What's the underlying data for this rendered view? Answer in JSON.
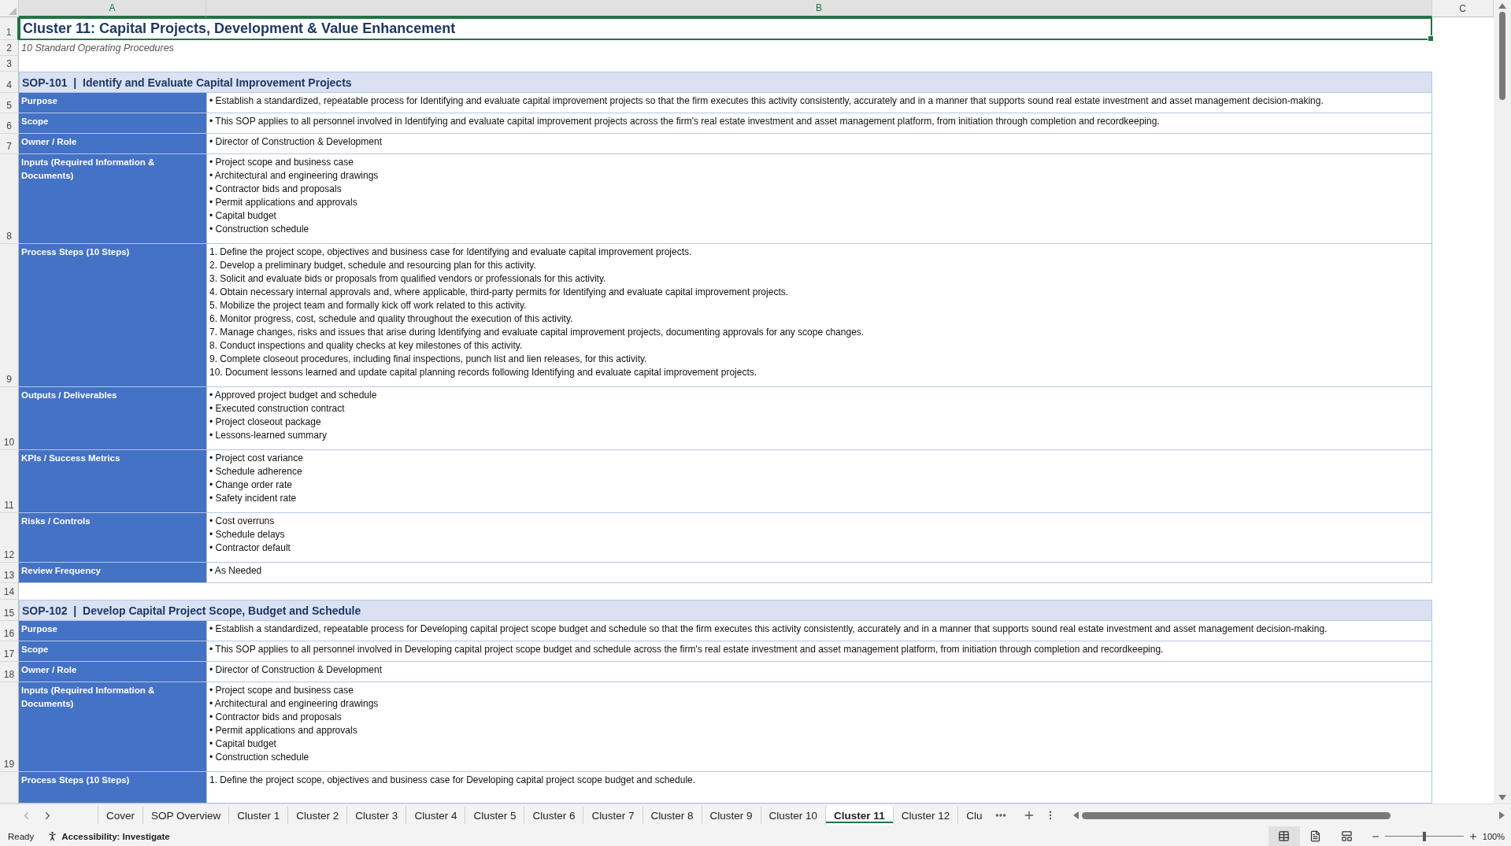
{
  "column_headers": [
    {
      "label": "A",
      "selected": true
    },
    {
      "label": "B",
      "selected": true
    },
    {
      "label": "C",
      "selected": false
    }
  ],
  "rows": [
    {
      "number": "1",
      "selected": true,
      "kind": "title",
      "text": "Cluster 11: Capital Projects, Development & Value Enhancement"
    },
    {
      "number": "2",
      "selected": false,
      "kind": "subtitle",
      "text": "10 Standard Operating Procedures"
    },
    {
      "number": "3",
      "selected": false,
      "kind": "blank"
    },
    {
      "number": "4",
      "selected": false,
      "kind": "heading",
      "text": "SOP-101  |  Identify and Evaluate Capital Improvement Projects"
    },
    {
      "number": "5",
      "selected": false,
      "kind": "field",
      "label": "Purpose",
      "lines": [
        "• Establish a standardized, repeatable process for Identifying and evaluate capital improvement projects so that the firm executes this activity consistently, accurately and in a manner that supports sound real estate investment and asset management decision-making."
      ]
    },
    {
      "number": "6",
      "selected": false,
      "kind": "field",
      "label": "Scope",
      "lines": [
        "• This SOP applies to all personnel involved in Identifying and evaluate capital improvement projects across the firm's real estate investment and asset management platform, from initiation through completion and recordkeeping."
      ]
    },
    {
      "number": "7",
      "selected": false,
      "kind": "field",
      "label": "Owner / Role",
      "lines": [
        "• Director of Construction & Development"
      ]
    },
    {
      "number": "8",
      "selected": false,
      "kind": "field",
      "label": "Inputs (Required Information & Documents)",
      "lines": [
        "• Project scope and business case",
        "• Architectural and engineering drawings",
        "• Contractor bids and proposals",
        "• Permit applications and approvals",
        "• Capital budget",
        "• Construction schedule"
      ]
    },
    {
      "number": "9",
      "selected": false,
      "kind": "field",
      "label": "Process Steps (10 Steps)",
      "lines": [
        "1. Define the project scope, objectives and business case for Identifying and evaluate capital improvement projects.",
        "2. Develop a preliminary budget, schedule and resourcing plan for this activity.",
        "3. Solicit and evaluate bids or proposals from qualified vendors or professionals for this activity.",
        "4. Obtain necessary internal approvals and, where applicable, third-party permits for Identifying and evaluate capital improvement projects.",
        "5. Mobilize the project team and formally kick off work related to this activity.",
        "6. Monitor progress, cost, schedule and quality throughout the execution of this activity.",
        "7. Manage changes, risks and issues that arise during Identifying and evaluate capital improvement projects, documenting approvals for any scope changes.",
        "8. Conduct inspections and quality checks at key milestones of this activity.",
        "9. Complete closeout procedures, including final inspections, punch list and lien releases, for this activity.",
        "10. Document lessons learned and update capital planning records following Identifying and evaluate capital improvement projects."
      ]
    },
    {
      "number": "10",
      "selected": false,
      "kind": "field",
      "label": "Outputs / Deliverables",
      "lines": [
        "• Approved project budget and schedule",
        "• Executed construction contract",
        "• Project closeout package",
        "• Lessons-learned summary"
      ]
    },
    {
      "number": "11",
      "selected": false,
      "kind": "field",
      "label": "KPIs / Success Metrics",
      "lines": [
        "• Project cost variance",
        "• Schedule adherence",
        "• Change order rate",
        "• Safety incident rate"
      ]
    },
    {
      "number": "12",
      "selected": false,
      "kind": "field",
      "label": "Risks / Controls",
      "lines": [
        "• Cost overruns",
        "• Schedule delays",
        "• Contractor default"
      ]
    },
    {
      "number": "13",
      "selected": false,
      "kind": "field",
      "label": "Review Frequency",
      "lines": [
        "• As Needed"
      ]
    },
    {
      "number": "14",
      "selected": false,
      "kind": "blank"
    },
    {
      "number": "15",
      "selected": false,
      "kind": "heading",
      "text": "SOP-102  |  Develop Capital Project Scope, Budget and Schedule"
    },
    {
      "number": "16",
      "selected": false,
      "kind": "field",
      "label": "Purpose",
      "lines": [
        "• Establish a standardized, repeatable process for Developing capital project scope budget and schedule so that the firm executes this activity consistently, accurately and in a manner that supports sound real estate investment and asset management decision-making."
      ]
    },
    {
      "number": "17",
      "selected": false,
      "kind": "field",
      "label": "Scope",
      "lines": [
        "• This SOP applies to all personnel involved in Developing capital project scope budget and schedule across the firm's real estate investment and asset management platform, from initiation through completion and recordkeeping."
      ]
    },
    {
      "number": "18",
      "selected": false,
      "kind": "field",
      "label": "Owner / Role",
      "lines": [
        "• Director of Construction & Development"
      ]
    },
    {
      "number": "19",
      "selected": false,
      "kind": "field",
      "label": "Inputs (Required Information & Documents)",
      "lines": [
        "• Project scope and business case",
        "• Architectural and engineering drawings",
        "• Contractor bids and proposals",
        "• Permit applications and approvals",
        "• Capital budget",
        "• Construction schedule"
      ]
    },
    {
      "selected": false,
      "kind": "partial",
      "label": "Process Steps (10 Steps)",
      "lines": [
        "1. Define the project scope, objectives and business case for Developing capital project scope budget and schedule."
      ]
    }
  ],
  "sheet_tabs": [
    {
      "label": "Cover",
      "selected": false
    },
    {
      "label": "SOP Overview",
      "selected": false
    },
    {
      "label": "Cluster 1",
      "selected": false
    },
    {
      "label": "Cluster 2",
      "selected": false
    },
    {
      "label": "Cluster 3",
      "selected": false
    },
    {
      "label": "Cluster 4",
      "selected": false
    },
    {
      "label": "Cluster 5",
      "selected": false
    },
    {
      "label": "Cluster 6",
      "selected": false
    },
    {
      "label": "Cluster 7",
      "selected": false
    },
    {
      "label": "Cluster 8",
      "selected": false
    },
    {
      "label": "Cluster 9",
      "selected": false
    },
    {
      "label": "Cluster 10",
      "selected": false
    },
    {
      "label": "Cluster 11",
      "selected": true
    },
    {
      "label": "Cluster 12",
      "selected": false
    },
    {
      "label": "Clu",
      "selected": false
    }
  ],
  "status_bar": {
    "status": "Ready",
    "accessibility": "Accessibility: Investigate",
    "view_buttons": [
      {
        "kind": "normal",
        "selected": true
      },
      {
        "kind": "page_layout",
        "selected": false
      },
      {
        "kind": "page_break",
        "selected": false
      }
    ],
    "zoom_slider": {
      "level": 0.5
    },
    "zoom": "100%"
  }
}
